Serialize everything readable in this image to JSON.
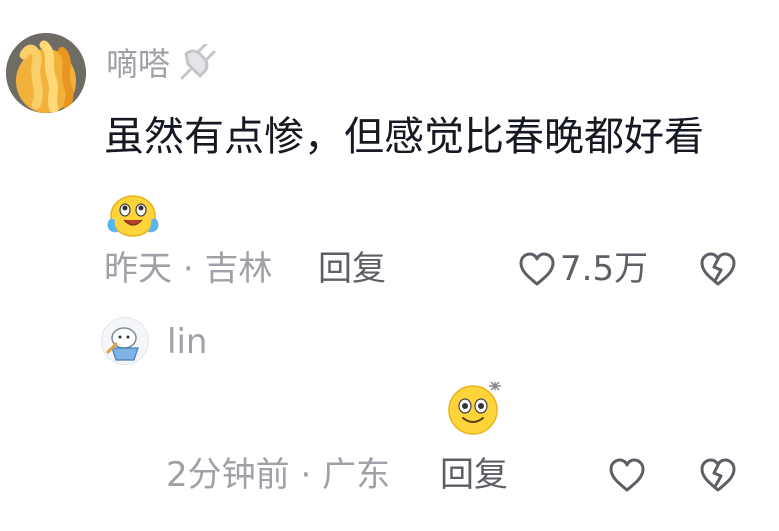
{
  "comment": {
    "username": "嘀嗒",
    "username_badge_icon": "plug-icon",
    "text": "虽然有点惨，但感觉比春晚都好看",
    "text_emoji": "crying-laughing-emoji",
    "time": "昨天",
    "separator": "·",
    "location": "吉林",
    "reply_label": "回复",
    "like_count": "7.5万",
    "like_icon": "heart-outline-icon",
    "dislike_icon": "broken-heart-icon"
  },
  "reply": {
    "username": "lin",
    "emoji": "smiling-wink-emoji",
    "time": "2分钟前",
    "separator": "·",
    "location": "广东",
    "reply_label": "回复",
    "like_icon": "heart-outline-icon",
    "dislike_icon": "broken-heart-icon"
  },
  "colors": {
    "primary_text": "#161823",
    "secondary_text": "#a0a1a8",
    "action_text": "#5e5f66"
  }
}
